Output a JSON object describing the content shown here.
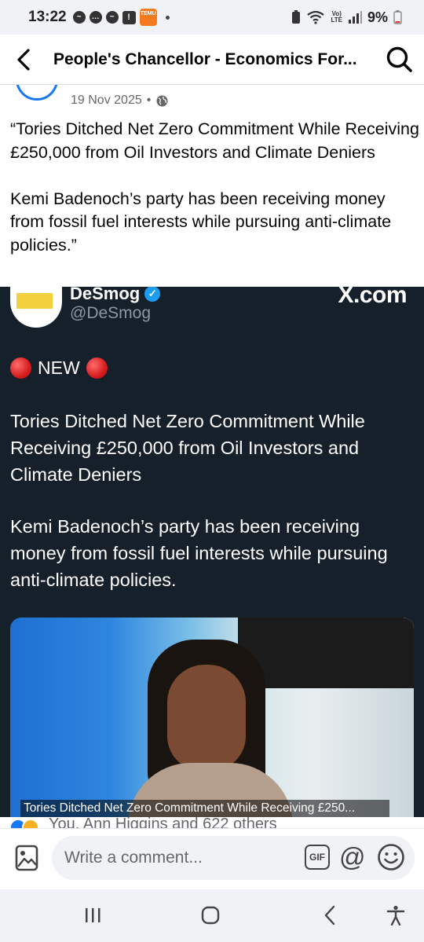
{
  "status_bar": {
    "time": "13:22",
    "temu_label": "TEMU",
    "network_label": "LTE",
    "battery": "9%"
  },
  "header": {
    "title": "People's Chancellor - Economics For..."
  },
  "post": {
    "author_partial": "",
    "date": "19 Nov 2025",
    "separator": "•",
    "paragraphs": [
      "“Tories Ditched Net Zero Commitment While Receiving £250,000 from Oil Investors and Climate Deniers",
      "Kemi Badenoch’s party has been receiving money from fossil fuel interests while pursuing anti-climate policies.”"
    ]
  },
  "tweet": {
    "name": "DeSmog",
    "handle": "@DeSmog",
    "platform": "X.com",
    "new_label": "NEW",
    "paragraphs": [
      "Tories Ditched Net Zero Commitment While Receiving £250,000 from Oil Investors and Climate Deniers",
      "Kemi Badenoch’s party has been receiving money from fossil fuel interests while pursuing anti-climate policies."
    ],
    "photo_caption": "Tories Ditched Net Zero Commitment While Receiving £250..."
  },
  "reactions": {
    "text": "You, Ann Higgins and 622 others"
  },
  "comment_bar": {
    "placeholder": "Write a comment...",
    "gif_label": "GIF",
    "mention_label": "@"
  },
  "colors": {
    "tweet_background": "#15202b",
    "facebook_blue": "#1877f2",
    "verified_blue": "#1d9bf0"
  }
}
